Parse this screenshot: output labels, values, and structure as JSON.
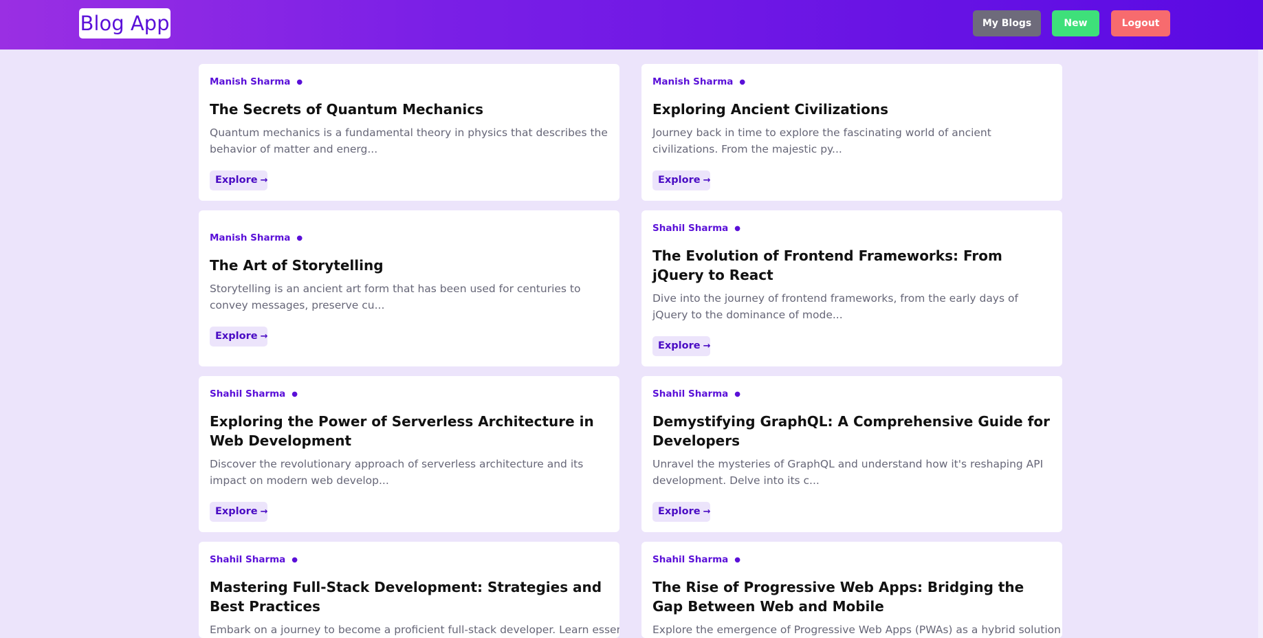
{
  "header": {
    "brand": "Blog App",
    "my_blogs_label": "My Blogs",
    "new_label": "New",
    "logout_label": "Logout"
  },
  "colors": {
    "accent": "#5a10d8",
    "page_bg": "#ece4fb",
    "my_blogs_bg": "#6e6b7b",
    "new_bg": "#3ee07a",
    "logout_bg": "#f76b6e"
  },
  "explore_label": "Explore",
  "posts": [
    {
      "author": "Manish Sharma",
      "title": "The Secrets of Quantum Mechanics",
      "excerpt": "Quantum mechanics is a fundamental theory in physics that describes the behavior of matter and energ..."
    },
    {
      "author": "Manish Sharma",
      "title": "Exploring Ancient Civilizations",
      "excerpt": "Journey back in time to explore the fascinating world of ancient civilizations. From the majestic py..."
    },
    {
      "author": "Manish Sharma",
      "title": "The Art of Storytelling",
      "excerpt": "Storytelling is an ancient art form that has been used for centuries to convey messages, preserve cu..."
    },
    {
      "author": "Shahil Sharma",
      "title": "The Evolution of Frontend Frameworks: From jQuery to React",
      "excerpt": "Dive into the journey of frontend frameworks, from the early days of jQuery to the dominance of mode..."
    },
    {
      "author": "Shahil Sharma",
      "title": "Exploring the Power of Serverless Architecture in Web Development",
      "excerpt": "Discover the revolutionary approach of serverless architecture and its impact on modern web develop..."
    },
    {
      "author": "Shahil Sharma",
      "title": "Demystifying GraphQL: A Comprehensive Guide for Developers",
      "excerpt": "Unravel the mysteries of GraphQL and understand how it's reshaping API development. Delve into its c..."
    },
    {
      "author": "Shahil Sharma",
      "title": "Mastering Full-Stack Development: Strategies and Best Practices",
      "excerpt": "Embark on a journey to become a proficient full-stack developer. Learn essential"
    },
    {
      "author": "Shahil Sharma",
      "title": "The Rise of Progressive Web Apps: Bridging the Gap Between Web and Mobile",
      "excerpt": "Explore the emergence of Progressive Web Apps (PWAs) as a hybrid solution for"
    }
  ]
}
